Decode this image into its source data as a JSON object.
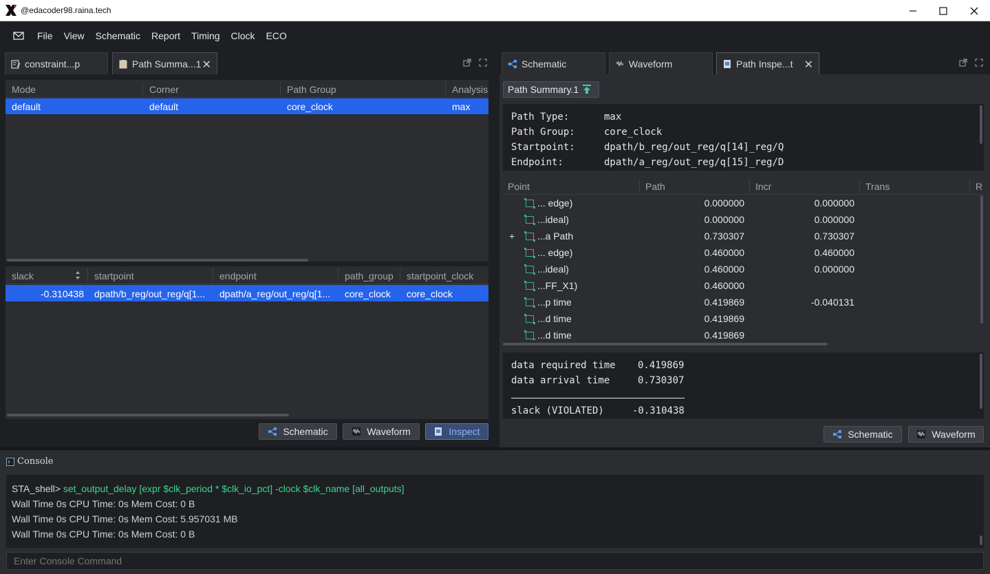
{
  "window": {
    "title": "@edacoder98.raina.tech"
  },
  "menu": [
    "File",
    "View",
    "Schematic",
    "Report",
    "Timing",
    "Clock",
    "ECO"
  ],
  "left_panel": {
    "tabs": [
      {
        "label": "constraint...p"
      },
      {
        "label": "Path Summa...1"
      }
    ],
    "summary_table": {
      "headers": [
        "Mode",
        "Corner",
        "Path Group",
        "Analysis"
      ],
      "rows": [
        [
          "default",
          "default",
          "core_clock",
          "max"
        ]
      ]
    },
    "path_table": {
      "headers": [
        "slack",
        "startpoint",
        "endpoint",
        "path_group",
        "startpoint_clock"
      ],
      "rows": [
        [
          "-0.310438",
          "dpath/b_reg/out_reg/q[1...",
          "dpath/a_reg/out_reg/q[1...",
          "core_clock",
          "core_clock"
        ]
      ]
    },
    "buttons": {
      "schematic": "Schematic",
      "waveform": "Waveform",
      "inspect": "Inspect"
    }
  },
  "right_panel": {
    "tabs": [
      {
        "label": "Schematic"
      },
      {
        "label": "Waveform"
      },
      {
        "label": "Path Inspe...t"
      }
    ],
    "source_chip": "Path Summary.1",
    "path_info": [
      {
        "key": "Path Type:",
        "value": "max"
      },
      {
        "key": "Path Group:",
        "value": "core_clock"
      },
      {
        "key": "Startpoint:",
        "value": "dpath/b_reg/out_reg/q[14]_reg/Q"
      },
      {
        "key": "Endpoint:",
        "value": "dpath/a_reg/out_reg/q[15]_reg/D"
      }
    ],
    "point_table": {
      "headers": [
        "Point",
        "Path",
        "Incr",
        "Trans",
        "R"
      ],
      "rows": [
        {
          "point": "... edge)",
          "path": "0.000000",
          "incr": "0.000000",
          "expand": ""
        },
        {
          "point": "...ideal)",
          "path": "0.000000",
          "incr": "0.000000",
          "expand": ""
        },
        {
          "point": "...a Path",
          "path": "0.730307",
          "incr": "0.730307",
          "expand": "+"
        },
        {
          "point": "... edge)",
          "path": "0.460000",
          "incr": "0.460000",
          "expand": ""
        },
        {
          "point": "...ideal)",
          "path": "0.460000",
          "incr": "0.000000",
          "expand": ""
        },
        {
          "point": "...FF_X1)",
          "path": "0.460000",
          "incr": "",
          "expand": ""
        },
        {
          "point": "...p time",
          "path": "0.419869",
          "incr": "-0.040131",
          "expand": ""
        },
        {
          "point": "...d time",
          "path": "0.419869",
          "incr": "",
          "expand": ""
        },
        {
          "point": "...d time",
          "path": "0.419869",
          "incr": "",
          "expand": ""
        }
      ]
    },
    "summary": {
      "required_label": "data required time",
      "required_value": "0.419869",
      "arrival_label": "data arrival time",
      "arrival_value": "0.730307",
      "slack_label": "slack (VIOLATED)",
      "slack_value": "-0.310438"
    },
    "buttons": {
      "schematic": "Schematic",
      "waveform": "Waveform"
    }
  },
  "console": {
    "title": "Console",
    "lines": [
      {
        "prompt": "STA_shell>",
        "command": "set_output_delay [expr $clk_period * $clk_io_pct] -clock $clk_name [all_outputs]"
      },
      {
        "text": "Wall Time 0s CPU Time: 0s Mem Cost: 0 B"
      },
      {
        "text": "Wall Time 0s CPU Time: 0s Mem Cost: 5.957031 MB"
      },
      {
        "text": "Wall Time 0s CPU Time: 0s Mem Cost: 0 B"
      }
    ],
    "input_placeholder": "Enter Console Command"
  },
  "colors": {
    "accent": "#2563eb",
    "command": "#3dd68c",
    "icon_green": "#3fb27f"
  }
}
